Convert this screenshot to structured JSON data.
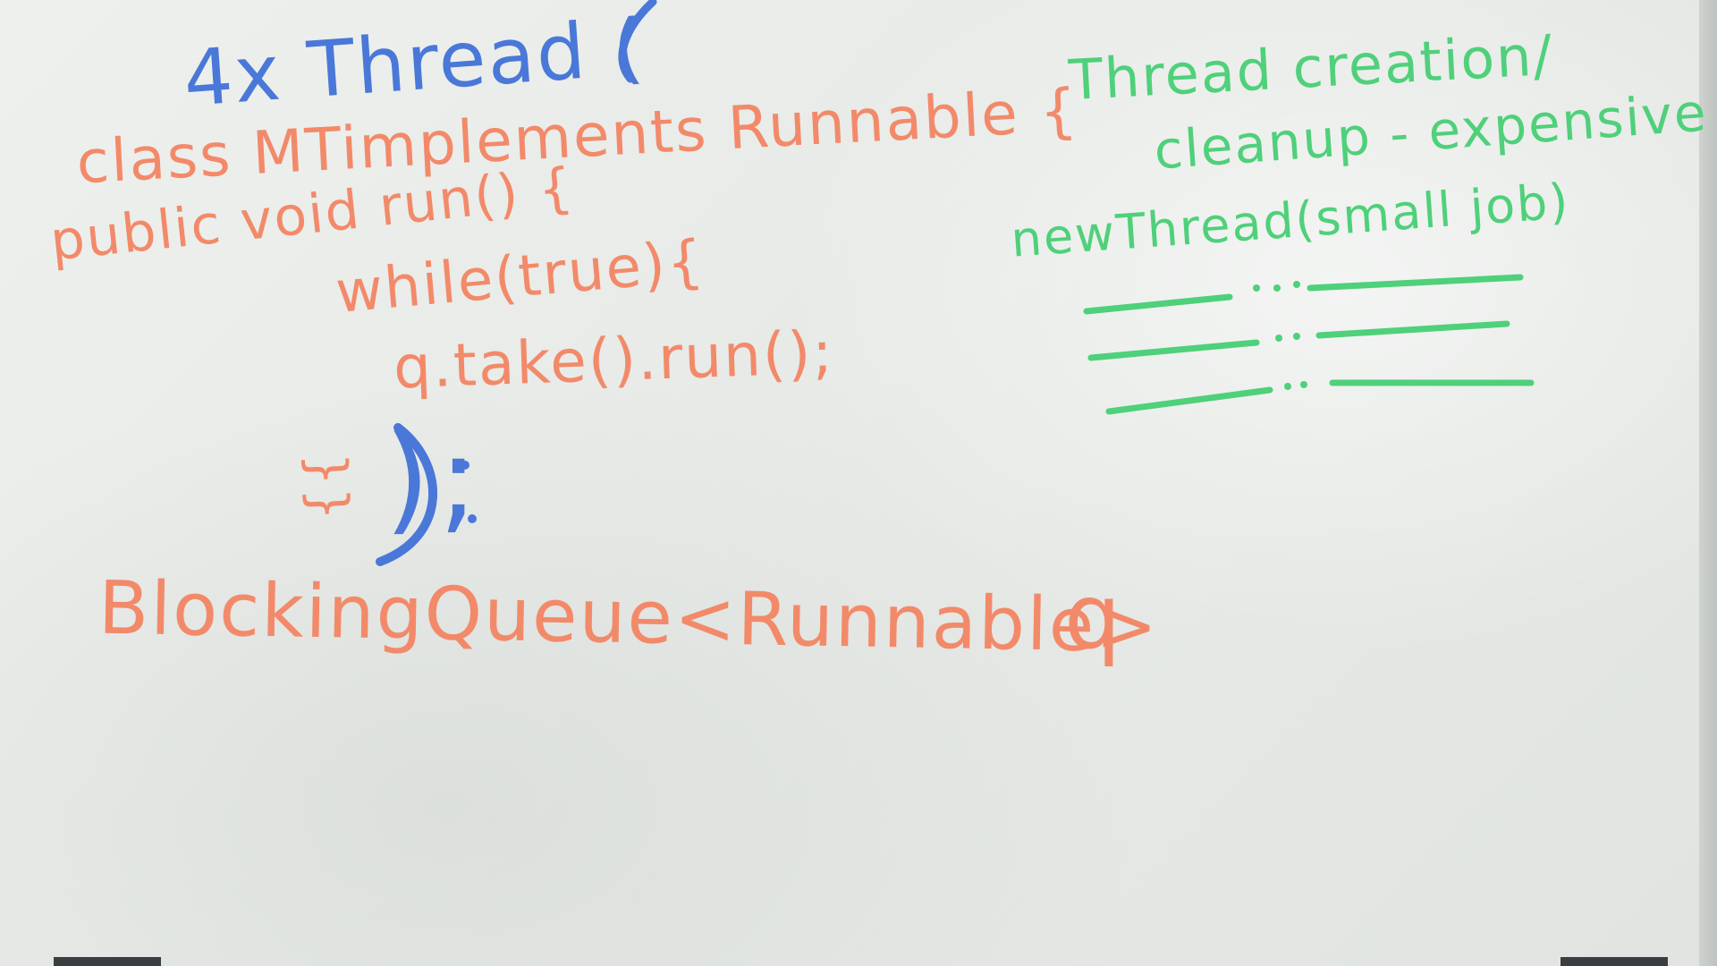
{
  "colors": {
    "orange_marker": "#f28a6a",
    "blue_marker": "#4a78d8",
    "green_marker": "#4fd07a",
    "board": "#e9ece9"
  },
  "whiteboard": {
    "blue_heading": "4x Thread (",
    "code_lines": [
      "class MTimplements Runnable {",
      "public void run() {",
      "while(true){",
      "q.take().run();",
      "}}"
    ],
    "closing_blue": ");",
    "queue_decl": "BlockingQueue<Runnable>",
    "queue_var": "q",
    "notes": {
      "line1": "Thread creation/",
      "line2": "cleanup - expensive",
      "line3": "newThread(small job)"
    }
  }
}
